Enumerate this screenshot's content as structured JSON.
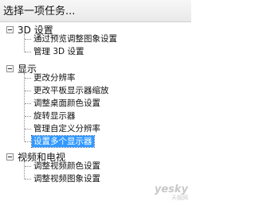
{
  "header": {
    "title": "选择一项任务..."
  },
  "tree": {
    "categories": [
      {
        "label": "3D 设置",
        "items": [
          "通过预览调整图象设置",
          "管理 3D 设置"
        ]
      },
      {
        "label": "显示",
        "items": [
          "更改分辨率",
          "更改平板显示器缩放",
          "调整桌面颜色设置",
          "旋转显示器",
          "管理自定义分辨率",
          "设置多个显示器"
        ],
        "selected_item": "设置多个显示器"
      },
      {
        "label": "视频和电视",
        "items": [
          "调整视频颜色设置",
          "调整视频图象设置"
        ]
      }
    ],
    "toggle_icon": "minus-collapse-icon"
  },
  "watermark": {
    "main": "yesky",
    "sub": "天极网"
  },
  "colors": {
    "selection": "#3399ff",
    "selection_text": "#ffffff"
  }
}
